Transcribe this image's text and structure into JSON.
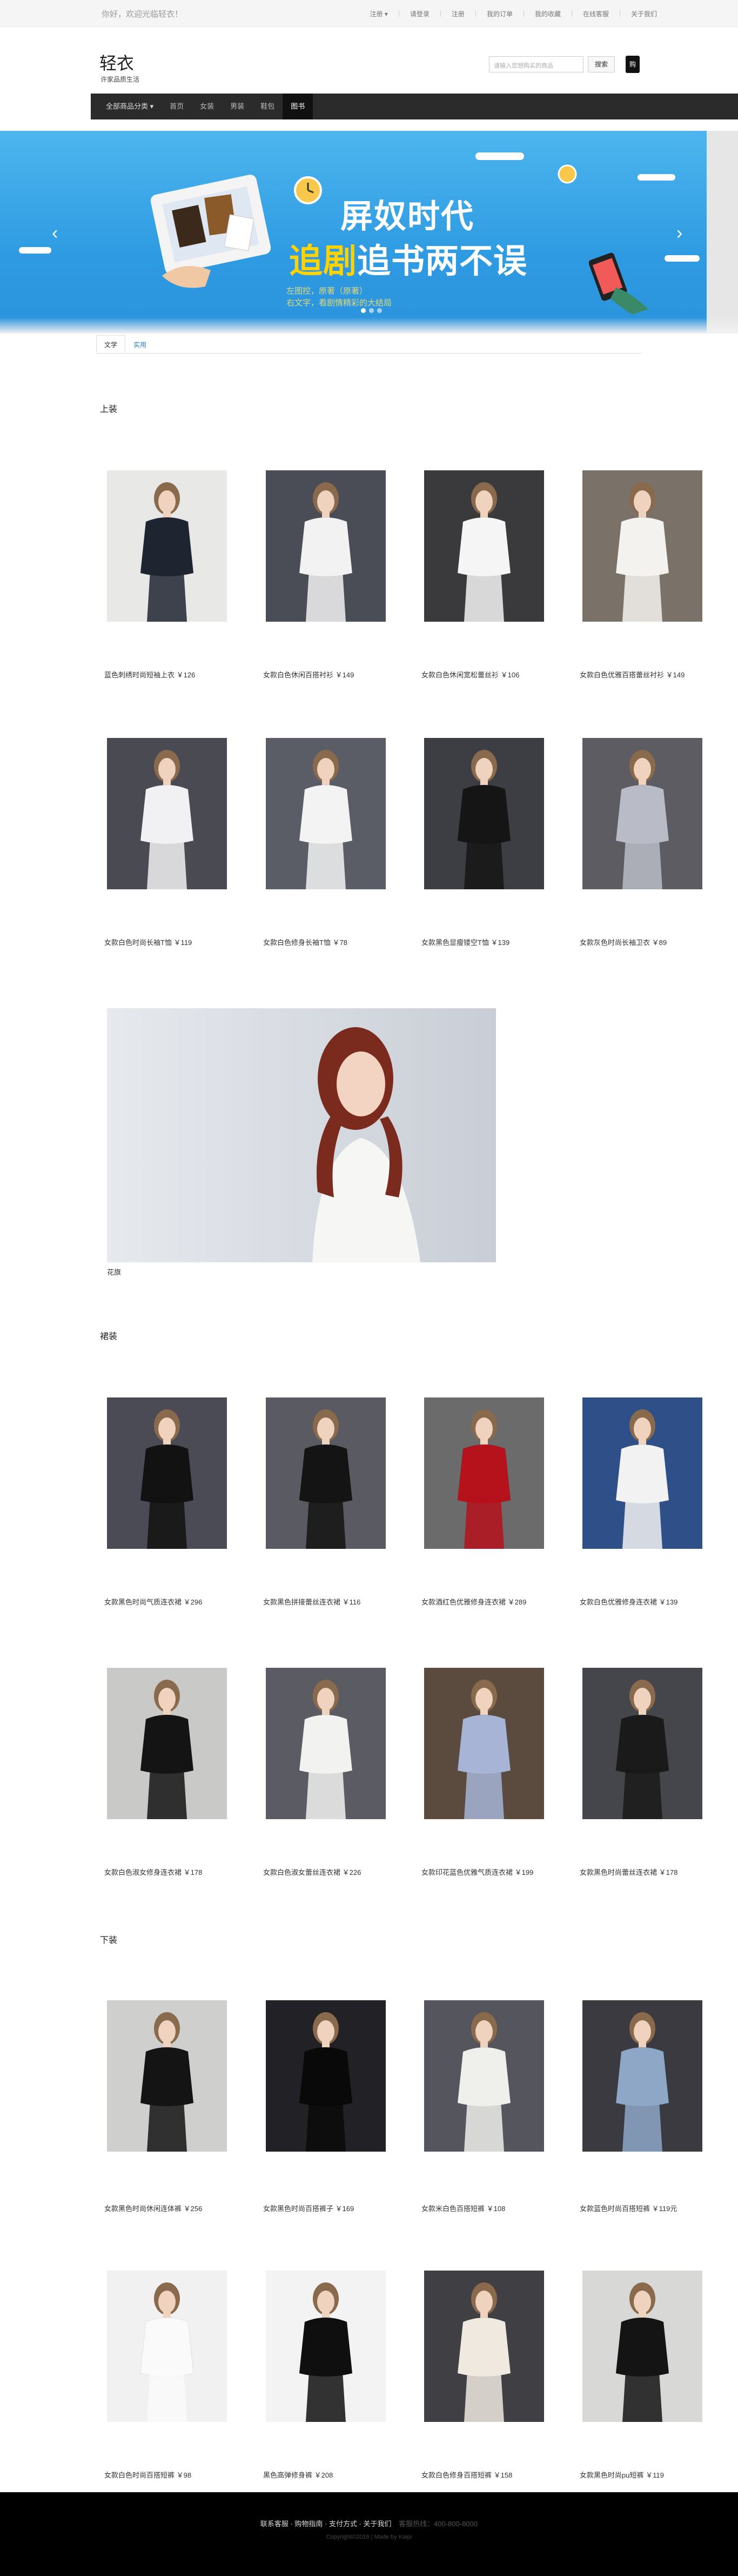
{
  "topbar": {
    "welcome": "你好，欢迎光临轻衣！",
    "links": [
      "注册 ▾",
      "请登录",
      "注册",
      "我的订单",
      "我的收藏",
      "在线客服",
      "关于我们"
    ]
  },
  "header": {
    "brand": "轻衣",
    "slogan": "许家品质生活",
    "search_placeholder": "请输入您想购买的商品",
    "search_button": "搜索",
    "cart_label": "购"
  },
  "nav": {
    "items": [
      "全部商品分类 ▾",
      "首页",
      "女装",
      "男装",
      "鞋包",
      "图书"
    ],
    "active_index": 5
  },
  "banner": {
    "headline": "屏奴时代",
    "headline2_a": "追剧",
    "headline2_b": "追书",
    "headline2_c": "两不误",
    "sub1": "左图控，原著（原著）",
    "sub2": "右文字，看剧情精彩的大结局",
    "prev_icon": "‹",
    "next_icon": "›"
  },
  "tabs": [
    {
      "label": "文学"
    },
    {
      "label": "实用"
    }
  ],
  "sections": [
    {
      "title": "上装",
      "items": [
        {
          "caption": "蓝色刺绣时尚短袖上衣 ￥126",
          "colors": [
            "#e8e8e6",
            "#1f2530"
          ]
        },
        {
          "caption": "女款白色休闲百搭衬衫 ￥149",
          "colors": [
            "#4a4c56",
            "#f2f2f2"
          ]
        },
        {
          "caption": "女款白色休闲宽松蕾丝衫 ￥106",
          "colors": [
            "#3a3a3d",
            "#f5f5f5"
          ]
        },
        {
          "caption": "女款白色优雅百搭蕾丝衬衫 ￥149",
          "colors": [
            "#7a7168",
            "#f4f2ef"
          ]
        },
        {
          "caption": "女款白色时尚长袖T恤 ￥119",
          "colors": [
            "#4a4a52",
            "#f1f1f3"
          ]
        },
        {
          "caption": "女款白色修身长袖T恤 ￥78",
          "colors": [
            "#5a5d66",
            "#f3f3f3"
          ]
        },
        {
          "caption": "女款黑色显瘦镂空T恤 ￥139",
          "colors": [
            "#3c3e44",
            "#151515"
          ]
        },
        {
          "caption": "女款灰色时尚长袖卫衣 ￥89",
          "colors": [
            "#5c5c62",
            "#b9bcc6"
          ]
        }
      ],
      "featured_caption": "花旗"
    },
    {
      "title": "裙装",
      "items": [
        {
          "caption": "女款黑色时尚气质连衣裙 ￥296",
          "colors": [
            "#4b4b55",
            "#121212"
          ]
        },
        {
          "caption": "女款黑色拼接蕾丝连衣裙 ￥116",
          "colors": [
            "#5a5a62",
            "#141414"
          ]
        },
        {
          "caption": "女款酒红色优雅修身连衣裙 ￥289",
          "colors": [
            "#6b6b6b",
            "#b5121b"
          ]
        },
        {
          "caption": "女款白色优雅修身连衣裙 ￥139",
          "colors": [
            "#2f4f88",
            "#f2f2f2"
          ]
        },
        {
          "caption": "女款白色淑女修身连衣裙 ￥178",
          "colors": [
            "#c9c9c7",
            "#141414"
          ]
        },
        {
          "caption": "女款白色淑女蕾丝连衣裙 ￥226",
          "colors": [
            "#5a5b63",
            "#f2f2f0"
          ]
        },
        {
          "caption": "女款印花蓝色优雅气质连衣裙 ￥199",
          "colors": [
            "#5a4b3e",
            "#a7b4d6"
          ]
        },
        {
          "caption": "女款黑色时尚蕾丝连衣裙 ￥178",
          "colors": [
            "#45454c",
            "#1a1a1a"
          ]
        }
      ]
    },
    {
      "title": "下装",
      "items": [
        {
          "caption": "女款黑色时尚休闲连体裤 ￥256",
          "colors": [
            "#cfcfcd",
            "#141414"
          ]
        },
        {
          "caption": "女款黑色时尚百搭裤子 ￥169",
          "colors": [
            "#222226",
            "#090909"
          ]
        },
        {
          "caption": "女款米白色百搭短裤 ￥108",
          "colors": [
            "#55565d",
            "#efefeb"
          ]
        },
        {
          "caption": "女款蓝色时尚百搭短裤 ￥119元",
          "colors": [
            "#3a3a40",
            "#8ea7c7"
          ]
        },
        {
          "caption": "女款白色时尚百搭短裤 ￥98",
          "colors": [
            "#f1f1f1",
            "#fafafa"
          ]
        },
        {
          "caption": "黑色高弹修身裤 ￥208",
          "colors": [
            "#f3f3f3",
            "#0f0f0f"
          ]
        },
        {
          "caption": "女款白色修身百搭短裤 ￥158",
          "colors": [
            "#3f3f44",
            "#efe9df"
          ]
        },
        {
          "caption": "女款黑色时尚pu短裤 ￥119",
          "colors": [
            "#d8d8d6",
            "#141414"
          ]
        }
      ]
    }
  ],
  "footer": {
    "links": "联系客服 · 购物指南 · 支付方式 · 关于我们",
    "extra": "客服热线：400-800-8000",
    "copyright": "Copyright©2016 | Made by Kaipi"
  }
}
